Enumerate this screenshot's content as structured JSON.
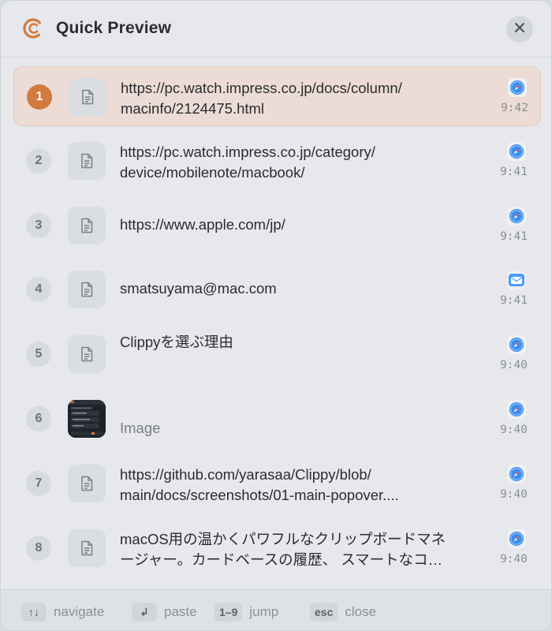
{
  "header": {
    "title": "Quick Preview",
    "logo_icon": "clippy-logo-icon",
    "close_icon": "close-icon",
    "accent": "#d37a3e"
  },
  "items": [
    {
      "index": "1",
      "lines": [
        "https://pc.watch.impress.co.jp/docs/column/",
        "macinfo/2124475.html"
      ],
      "time": "9:42",
      "app": "safari-icon",
      "type": "text",
      "selected": true
    },
    {
      "index": "2",
      "lines": [
        "https://pc.watch.impress.co.jp/category/",
        "device/mobilenote/macbook/"
      ],
      "time": "9:41",
      "app": "safari-icon",
      "type": "text"
    },
    {
      "index": "3",
      "lines": [
        "https://www.apple.com/jp/"
      ],
      "time": "9:41",
      "app": "safari-icon",
      "type": "text"
    },
    {
      "index": "4",
      "lines": [
        "smatsuyama@mac.com"
      ],
      "time": "9:41",
      "app": "mail-icon",
      "type": "text"
    },
    {
      "index": "5",
      "lines": [
        "Clippyを選ぶ理由"
      ],
      "time": "9:40",
      "app": "safari-icon",
      "type": "text"
    },
    {
      "index": "6",
      "lines": [
        "Image"
      ],
      "time": "9:40",
      "app": "safari-icon",
      "type": "image"
    },
    {
      "index": "7",
      "lines": [
        "https://github.com/yarasaa/Clippy/blob/",
        "main/docs/screenshots/01-main-popover...."
      ],
      "time": "9:40",
      "app": "safari-icon",
      "type": "text"
    },
    {
      "index": "8",
      "lines": [
        "macOS用の温かくパワフルなクリップボードマネ",
        "ージャー。カードベースの履歴、 スマートなコ…"
      ],
      "time": "9:40",
      "app": "safari-icon",
      "type": "text"
    }
  ],
  "footer": {
    "hints": [
      {
        "key": "↑↓",
        "label": "navigate"
      },
      {
        "key": "↲",
        "label": "paste"
      },
      {
        "key": "1–9",
        "label": "jump"
      },
      {
        "key": "esc",
        "label": "close"
      }
    ]
  }
}
